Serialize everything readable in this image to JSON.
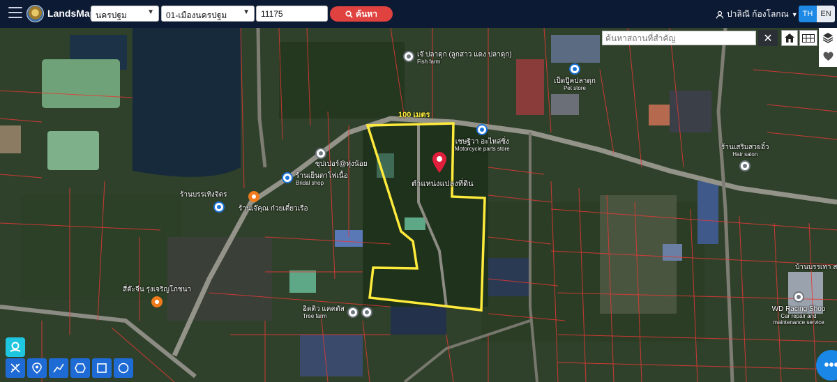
{
  "header": {
    "brand": "LandsMaps",
    "province_select": "นครปฐม",
    "district_select": "01-เมืองนครปฐม",
    "parcel_input": "11175",
    "search_label": "ค้นหา",
    "user_name": "ปาลิณี ก้องโลกณ",
    "lang_th": "TH",
    "lang_en": "EN"
  },
  "map": {
    "place_search_placeholder": "ค้นหาสถานที่สำคัญ",
    "distance_label": "100 เมตร",
    "plot_label": "ตำแหน่งแปลงที่ดิน",
    "highlight_color": "#ffeb3b",
    "parcel_line_color": "#e53935",
    "pois": [
      {
        "name": "เจ๊ ปลาดุก (ลูกสาว แดง ปลาดุก)",
        "sub": "Fish farm",
        "type": "gray"
      },
      {
        "name": "เป็ดปู๊คปลาดุก",
        "sub": "Pet store",
        "type": "blue"
      },
      {
        "name": "เชษฐิวา อะไหล่ซิ่ง",
        "sub": "Motorcycle parts store",
        "type": "blue"
      },
      {
        "name": "ร้านเสริมสวยอิ๋ว",
        "sub": "Hair salon",
        "type": "gray"
      },
      {
        "name": "ซุปเปอร์@ทุ่งน้อย",
        "sub": "",
        "type": "gray"
      },
      {
        "name": "ร้านเย็นตาโฟเนื้อ",
        "sub": "Bridal shop",
        "type": "blue"
      },
      {
        "name": "ร้านบรรเทิงจิตร",
        "sub": "",
        "type": "blue"
      },
      {
        "name": "ร้านเจ๊คุณ ก๋วยเตี๋ยวเรือ",
        "sub": "",
        "type": "orange"
      },
      {
        "name": "สี่ต๊ะจีน รุ่งเจริญโภชนา",
        "sub": "",
        "type": "orange"
      },
      {
        "name": "อิดติว แคคตัส",
        "sub": "Tree farm",
        "type": "gray"
      },
      {
        "name": "บ้านบรรเทา สวนดอกไม้",
        "sub": "",
        "type": "gray"
      },
      {
        "name": "WD Racing Shop",
        "sub": "Car repair and maintenance service",
        "type": "gray"
      }
    ]
  }
}
